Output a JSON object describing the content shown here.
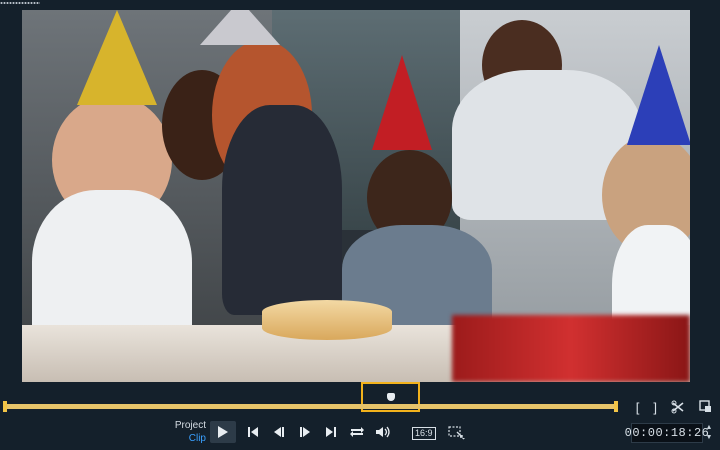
{
  "preview": {
    "description_alt": ""
  },
  "playback": {
    "mode_project": "Project",
    "mode_clip": "Clip",
    "aspect_ratio": "16:9",
    "timecode": "00:00:18:26"
  },
  "icons": {
    "play": "play-icon",
    "home": "go-to-start-icon",
    "prev_frame": "previous-frame-icon",
    "next_frame": "next-frame-icon",
    "end": "go-to-end-icon",
    "repeat": "repeat-icon",
    "volume": "volume-icon",
    "mark_in": "mark-in-icon",
    "mark_out": "mark-out-icon",
    "split": "split-clip-icon",
    "enlarge": "enlarge-preview-icon"
  },
  "colors": {
    "accent": "#f2b21c",
    "clip_mode": "#3aa0ff",
    "background": "#14202b"
  }
}
